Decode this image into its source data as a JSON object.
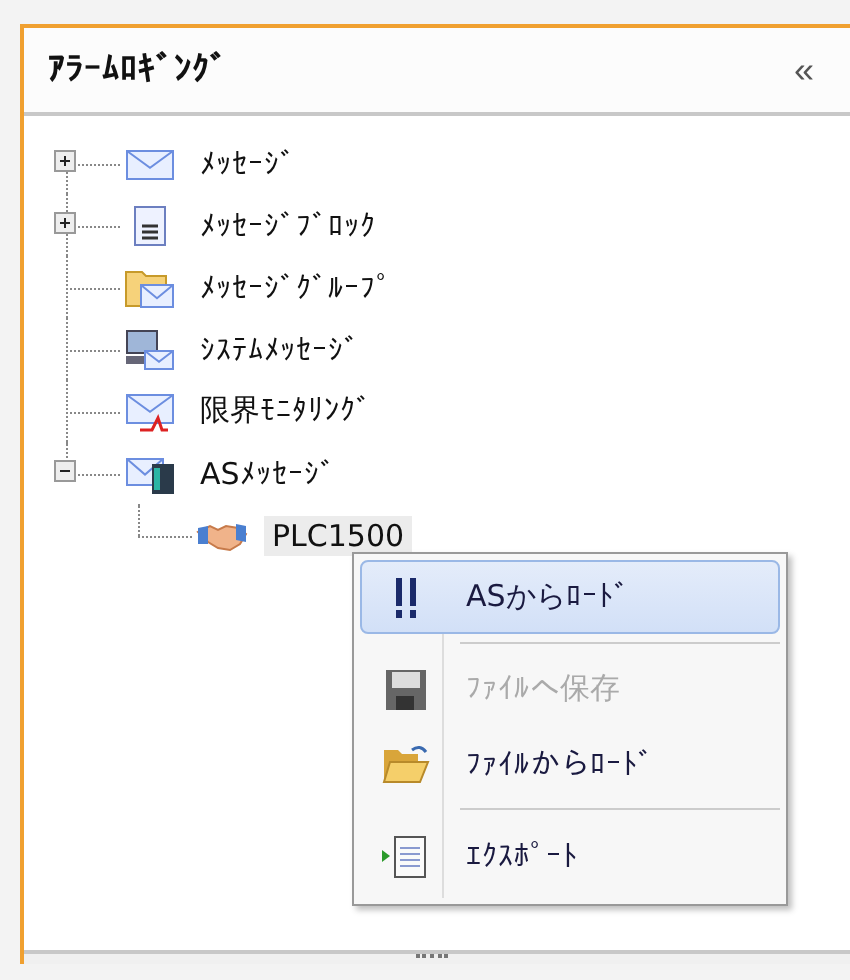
{
  "panel": {
    "title": "ｱﾗｰﾑﾛｷﾞﾝｸﾞ",
    "collapse_button": "«"
  },
  "tree": [
    {
      "label": "ﾒｯｾｰｼﾞ",
      "kind": "envelope",
      "expanded": false,
      "selected": false
    },
    {
      "label": "ﾒｯｾｰｼﾞﾌﾞﾛｯｸ",
      "kind": "document",
      "expanded": false,
      "selected": false
    },
    {
      "label": "ﾒｯｾｰｼﾞｸﾞﾙｰﾌﾟ",
      "kind": "folder",
      "selected": false
    },
    {
      "label": "ｼｽﾃﾑﾒｯｾｰｼﾞ",
      "kind": "computer",
      "selected": false
    },
    {
      "label": "限界ﾓﾆﾀﾘﾝｸﾞ",
      "kind": "limit",
      "selected": false
    },
    {
      "label": "ASﾒｯｾｰｼﾞ",
      "kind": "device",
      "expanded": true,
      "selected": false,
      "children": [
        {
          "label": "PLC1500",
          "kind": "handshake",
          "selected": true
        }
      ]
    }
  ],
  "context_menu": [
    {
      "kind": "bars",
      "label": "ASからﾛｰﾄﾞ",
      "selected": true,
      "disabled": false
    },
    {
      "kind": "separator"
    },
    {
      "kind": "disk",
      "label": "ﾌｧｲﾙへ保存",
      "selected": false,
      "disabled": true
    },
    {
      "kind": "folder",
      "label": "ﾌｧｲﾙからﾛｰﾄﾞ",
      "selected": false,
      "disabled": false
    },
    {
      "kind": "separator"
    },
    {
      "kind": "export",
      "label": "ｴｸｽﾎﾟｰﾄ",
      "selected": false,
      "disabled": false
    }
  ]
}
